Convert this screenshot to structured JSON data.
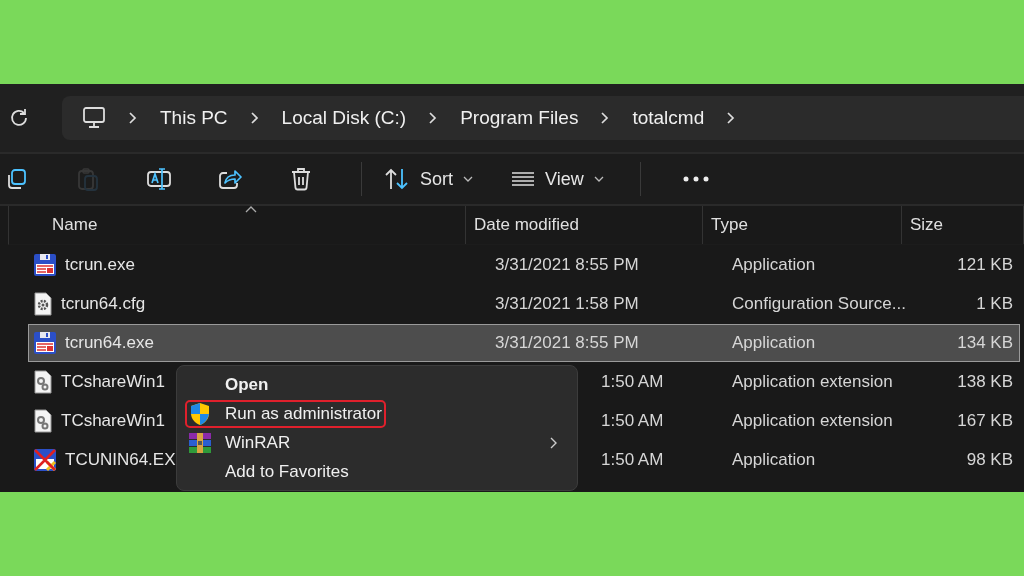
{
  "breadcrumb": [
    {
      "label": "This PC"
    },
    {
      "label": "Local Disk (C:)"
    },
    {
      "label": "Program Files"
    },
    {
      "label": "totalcmd"
    }
  ],
  "toolbar": {
    "buttons": [
      {
        "kind": "copy",
        "disabled": false
      },
      {
        "kind": "paste",
        "disabled": true
      },
      {
        "kind": "rename",
        "disabled": false
      },
      {
        "kind": "share",
        "disabled": false
      },
      {
        "kind": "delete",
        "disabled": false
      }
    ],
    "sort": "Sort",
    "view": "View"
  },
  "table": {
    "columns": [
      "Name",
      "Date modified",
      "Type",
      "Size"
    ],
    "rows": [
      {
        "kind": "exe",
        "name": "tcrun.exe",
        "date": "3/31/2021 8:55 PM",
        "type": "Application",
        "size": "121 KB",
        "selected": false,
        "under_menu": false
      },
      {
        "kind": "cfg",
        "name": "tcrun64.cfg",
        "date": "3/31/2021 1:58 PM",
        "type": "Configuration Source...",
        "size": "1 KB",
        "selected": false,
        "under_menu": false
      },
      {
        "kind": "exe",
        "name": "tcrun64.exe",
        "date": "3/31/2021 8:55 PM",
        "type": "Application",
        "size": "134 KB",
        "selected": true,
        "under_menu": false
      },
      {
        "kind": "dll",
        "name": "TCshareWin1",
        "date": "1:50 AM",
        "type": "Application extension",
        "size": "138 KB",
        "selected": false,
        "under_menu": true
      },
      {
        "kind": "dll",
        "name": "TCshareWin1",
        "date": "1:50 AM",
        "type": "Application extension",
        "size": "167 KB",
        "selected": false,
        "under_menu": true
      },
      {
        "kind": "uninstall",
        "name": "TCUNIN64.EX",
        "date": "1:50 AM",
        "type": "Application",
        "size": "98 KB",
        "selected": false,
        "under_menu": true
      }
    ]
  },
  "context_menu": {
    "items": [
      {
        "kind": "open",
        "label": "Open",
        "highlighted": false,
        "submenu": false
      },
      {
        "kind": "shield",
        "label": "Run as administrator",
        "highlighted": true,
        "submenu": false
      },
      {
        "kind": "winrar",
        "label": "WinRAR",
        "highlighted": false,
        "submenu": true
      },
      {
        "kind": "plain",
        "label": "Add to Favorites",
        "highlighted": false,
        "submenu": false
      }
    ]
  }
}
